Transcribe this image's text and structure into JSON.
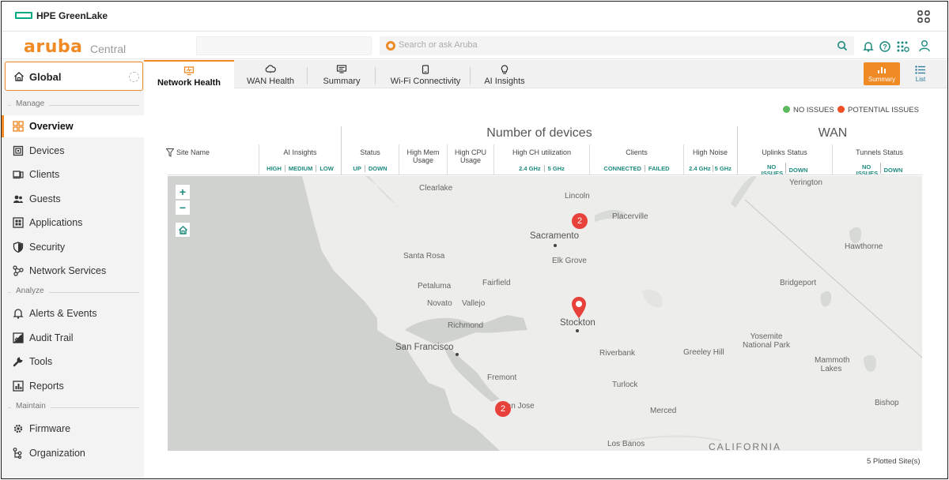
{
  "hpe": {
    "brand": "HPE GreenLake"
  },
  "header": {
    "logo": "aruba",
    "product": "Central",
    "search_placeholder": "Search or ask Aruba"
  },
  "sidebar": {
    "scope": "Global",
    "sections": {
      "manage": "Manage",
      "analyze": "Analyze",
      "maintain": "Maintain"
    },
    "items": [
      {
        "label": "Overview",
        "icon": "overview-grid-icon",
        "active": true
      },
      {
        "label": "Devices",
        "icon": "devices-icon"
      },
      {
        "label": "Clients",
        "icon": "clients-icon"
      },
      {
        "label": "Guests",
        "icon": "guests-icon"
      },
      {
        "label": "Applications",
        "icon": "applications-icon"
      },
      {
        "label": "Security",
        "icon": "shield-icon"
      },
      {
        "label": "Network Services",
        "icon": "network-services-icon"
      },
      {
        "label": "Alerts & Events",
        "icon": "bell-icon"
      },
      {
        "label": "Audit Trail",
        "icon": "audit-trail-icon"
      },
      {
        "label": "Tools",
        "icon": "wrench-icon"
      },
      {
        "label": "Reports",
        "icon": "reports-icon"
      },
      {
        "label": "Firmware",
        "icon": "firmware-gear-icon"
      },
      {
        "label": "Organization",
        "icon": "organization-icon"
      }
    ]
  },
  "tabs": [
    {
      "label": "Network Health",
      "icon": "monitor-icon",
      "active": true
    },
    {
      "label": "WAN Health",
      "icon": "cloud-icon"
    },
    {
      "label": "Summary",
      "icon": "summary-icon"
    },
    {
      "label": "Wi-Fi Connectivity",
      "icon": "phone-icon"
    },
    {
      "label": "AI Insights",
      "icon": "lightbulb-icon"
    }
  ],
  "views": {
    "summary": "Summary",
    "list": "List"
  },
  "legend": {
    "no_issues": "NO ISSUES",
    "potential_issues": "POTENTIAL ISSUES",
    "no_issues_color": "#5cb85c",
    "potential_issues_color": "#f04e23"
  },
  "table_header": {
    "group_devices": "Number of devices",
    "group_wan": "WAN",
    "site_name": "Site Name",
    "ai_insights": {
      "label": "AI Insights",
      "subs": [
        "HIGH",
        "MEDIUM",
        "LOW"
      ]
    },
    "status": {
      "label": "Status",
      "subs": [
        "UP",
        "DOWN"
      ]
    },
    "high_mem": "High Mem Usage",
    "high_cpu": "High CPU Usage",
    "high_ch": {
      "label": "High CH utilization",
      "subs": [
        "2.4 GHz",
        "5 GHz"
      ]
    },
    "clients": {
      "label": "Clients",
      "subs": [
        "CONNECTED",
        "FAILED"
      ]
    },
    "high_noise": {
      "label": "High Noise",
      "subs": [
        "2.4 GHz",
        "5 GHz"
      ]
    },
    "uplinks": {
      "label": "Uplinks Status",
      "subs": [
        "NO ISSUES",
        "DOWN"
      ]
    },
    "tunnels": {
      "label": "Tunnels Status",
      "subs": [
        "NO ISSUES",
        "DOWN"
      ]
    }
  },
  "map": {
    "zoom_in": "+",
    "zoom_out": "−",
    "cities": {
      "clearlake": "Clearlake",
      "lincoln": "Lincoln",
      "placerville": "Placerville",
      "yerington": "Yerington",
      "sacramento": "Sacramento",
      "santa_rosa": "Santa Rosa",
      "elk_grove": "Elk Grove",
      "hawthorne": "Hawthorne",
      "petaluma": "Petaluma",
      "fairfield": "Fairfield",
      "bridgeport": "Bridgeport",
      "novato": "Novato",
      "vallejo": "Vallejo",
      "stockton": "Stockton",
      "richmond": "Richmond",
      "yosemite": "Yosemite National Park",
      "san_francisco": "San Francisco",
      "riverbank": "Riverbank",
      "greeley_hill": "Greeley Hill",
      "mammoth": "Mammoth Lakes",
      "fremont": "Fremont",
      "turlock": "Turlock",
      "san_jose": "San Jose",
      "merced": "Merced",
      "bishop": "Bishop",
      "los_banos": "Los Banos",
      "california": "CALIFORNIA"
    },
    "markers": [
      {
        "kind": "cluster",
        "count": "2",
        "near": "Sacramento"
      },
      {
        "kind": "pin",
        "near": "Stockton"
      },
      {
        "kind": "cluster",
        "count": "2",
        "near": "San Jose"
      }
    ]
  },
  "footer": {
    "plotted": "5 Plotted Site(s)"
  }
}
